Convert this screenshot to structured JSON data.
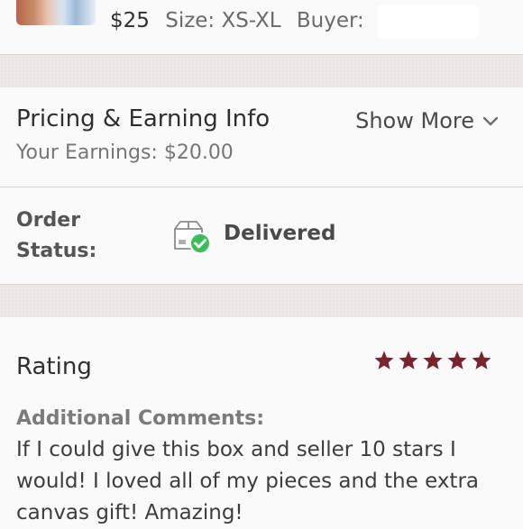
{
  "listing": {
    "price": "$25",
    "size": "Size: XS-XL",
    "buyer_label": "Buyer:"
  },
  "pricing": {
    "title": "Pricing & Earning Info",
    "show_more": "Show More",
    "earnings": "Your Earnings: $20.00"
  },
  "order": {
    "label_line1": "Order",
    "label_line2": "Status:",
    "status": "Delivered",
    "status_icon": "delivered-box-check-icon"
  },
  "rating": {
    "title": "Rating",
    "stars": 5,
    "stars_max": 5,
    "star_color": "#7a2330",
    "comments_label": "Additional Comments:",
    "comments": "If I could give this box and seller 10 stars I would! I loved all of my pieces and the extra canvas gift! Amazing!"
  },
  "colors": {
    "delivered_green": "#3bbd5a",
    "separator_band": "#ede9e4"
  }
}
